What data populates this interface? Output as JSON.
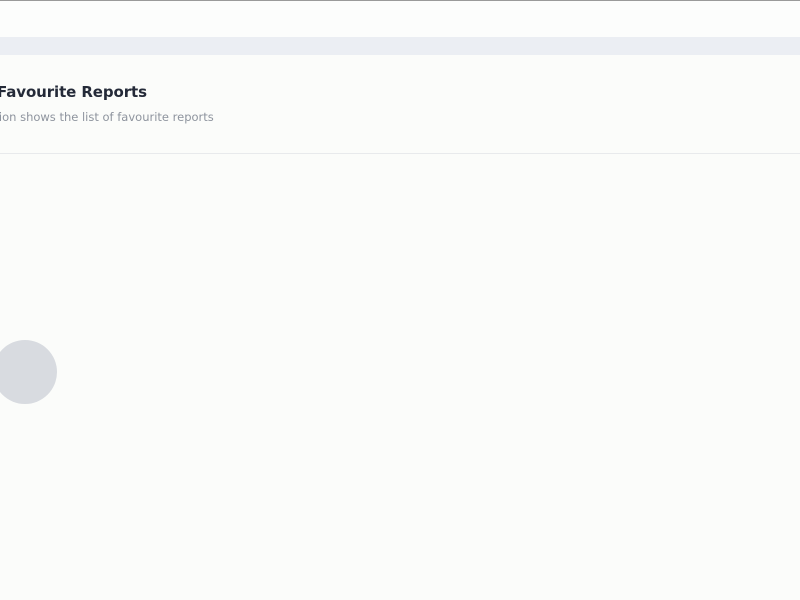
{
  "section": {
    "title": "Favourite Reports",
    "subtitle": "section shows the list of favourite reports"
  },
  "colors": {
    "page_background": "#fbfcfa",
    "band": "#ebeef3",
    "title_text": "#242a38",
    "subtitle_text": "#8e949e",
    "loader_placeholder": "#d8dbe0"
  }
}
